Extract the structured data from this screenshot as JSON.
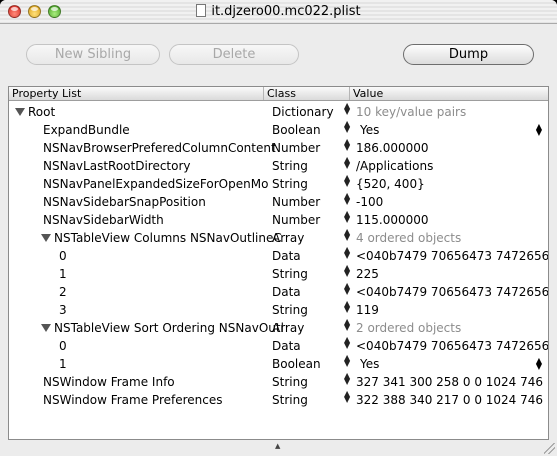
{
  "window": {
    "title": "it.djzero00.mc022.plist"
  },
  "toolbar": {
    "new_sibling": "New Sibling",
    "delete": "Delete",
    "dump": "Dump"
  },
  "table": {
    "headers": [
      "Property List",
      "Class",
      "Value"
    ],
    "rows": [
      {
        "name": "Root",
        "class": "Dictionary",
        "value": "10 key/value pairs",
        "indent": 0,
        "disclosure": true,
        "value_style": "gray",
        "control": "stepper"
      },
      {
        "name": "ExpandBundle",
        "class": "Boolean",
        "value": "Yes",
        "indent": 1,
        "disclosure": false,
        "value_style": "normal",
        "control": "popup"
      },
      {
        "name": "NSNavBrowserPreferedColumnContent",
        "class": "Number",
        "value": "186.000000",
        "indent": 1,
        "disclosure": false,
        "value_style": "normal",
        "control": "stepper"
      },
      {
        "name": "NSNavLastRootDirectory",
        "class": "String",
        "value": "/Applications",
        "indent": 1,
        "disclosure": false,
        "value_style": "normal",
        "control": "stepper"
      },
      {
        "name": "NSNavPanelExpandedSizeForOpenMo",
        "class": "String",
        "value": "{520, 400}",
        "indent": 1,
        "disclosure": false,
        "value_style": "normal",
        "control": "stepper"
      },
      {
        "name": "NSNavSidebarSnapPosition",
        "class": "Number",
        "value": "-100",
        "indent": 1,
        "disclosure": false,
        "value_style": "normal",
        "control": "stepper"
      },
      {
        "name": "NSNavSidebarWidth",
        "class": "Number",
        "value": "115.000000",
        "indent": 1,
        "disclosure": false,
        "value_style": "normal",
        "control": "stepper"
      },
      {
        "name": "NSTableView Columns NSNavOutlineC",
        "class": "Array",
        "value": "4 ordered objects",
        "indent": 1,
        "disclosure": true,
        "value_style": "gray",
        "control": "stepper"
      },
      {
        "name": "0",
        "class": "Data",
        "value": "<040b7479 70656473 74726561 6",
        "indent": 2,
        "disclosure": false,
        "value_style": "normal",
        "control": "stepper"
      },
      {
        "name": "1",
        "class": "String",
        "value": "225",
        "indent": 2,
        "disclosure": false,
        "value_style": "normal",
        "control": "stepper"
      },
      {
        "name": "2",
        "class": "Data",
        "value": "<040b7479 70656473 74726561 6",
        "indent": 2,
        "disclosure": false,
        "value_style": "normal",
        "control": "stepper"
      },
      {
        "name": "3",
        "class": "String",
        "value": "119",
        "indent": 2,
        "disclosure": false,
        "value_style": "normal",
        "control": "stepper"
      },
      {
        "name": "NSTableView Sort Ordering NSNavOutl",
        "class": "Array",
        "value": "2 ordered objects",
        "indent": 1,
        "disclosure": true,
        "value_style": "gray",
        "control": "stepper"
      },
      {
        "name": "0",
        "class": "Data",
        "value": "<040b7479 70656473 74726561 6",
        "indent": 2,
        "disclosure": false,
        "value_style": "normal",
        "control": "stepper"
      },
      {
        "name": "1",
        "class": "Boolean",
        "value": "Yes",
        "indent": 2,
        "disclosure": false,
        "value_style": "normal",
        "control": "popup"
      },
      {
        "name": "NSWindow Frame Info",
        "class": "String",
        "value": "327 341 300 258 0 0 1024 746",
        "indent": 1,
        "disclosure": false,
        "value_style": "normal",
        "control": "stepper"
      },
      {
        "name": "NSWindow Frame Preferences",
        "class": "String",
        "value": "322 388 340 217 0 0 1024 746",
        "indent": 1,
        "disclosure": false,
        "value_style": "normal",
        "control": "stepper"
      }
    ]
  }
}
